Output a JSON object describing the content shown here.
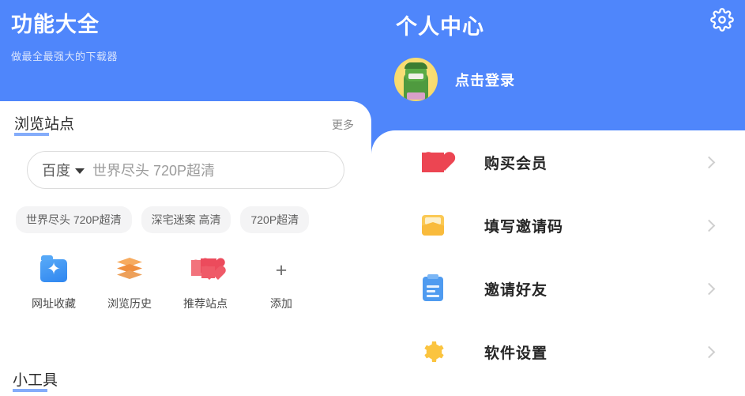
{
  "theme": {
    "brand_blue": "#4f86fb",
    "accent_underline": "#6f9df9",
    "card_white": "#ffffff"
  },
  "left_panel": {
    "title": "功能大全",
    "subtitle": "做最全最强大的下载器",
    "section": {
      "title": "浏览站点",
      "more_label": "更多"
    },
    "search": {
      "engine_label": "百度",
      "engine_caret_icon": "caret-down-icon",
      "placeholder": "世界尽头 720P超清",
      "value": ""
    },
    "history_tags": [
      "世界尽头 720P超清",
      "深宅迷案 高清",
      "720P超清"
    ],
    "shortcuts": [
      {
        "label": "网址收藏",
        "icon": "folder-star-icon",
        "color": "#2f86f0"
      },
      {
        "label": "浏览历史",
        "icon": "layers-icon",
        "color": "#f0903f"
      },
      {
        "label": "推荐站点",
        "icon": "hearts-icon",
        "color": "#ec4b5c"
      },
      {
        "label": "添加",
        "icon": "plus-icon",
        "color": "#6e6e6e"
      }
    ],
    "tools_section_title": "小工具"
  },
  "right_panel": {
    "title": "个人中心",
    "settings_icon": "gear-icon",
    "profile": {
      "avatar_icon": "avatar-hulk-icon",
      "login_label": "点击登录"
    },
    "menu": [
      {
        "label": "购买会员",
        "icon": "heart-icon",
        "chevron": "chevron-right-icon"
      },
      {
        "label": "填写邀请码",
        "icon": "envelope-icon",
        "chevron": "chevron-right-icon"
      },
      {
        "label": "邀请好友",
        "icon": "clipboard-icon",
        "chevron": "chevron-right-icon"
      },
      {
        "label": "软件设置",
        "icon": "gear-icon",
        "chevron": "chevron-right-icon"
      }
    ]
  }
}
